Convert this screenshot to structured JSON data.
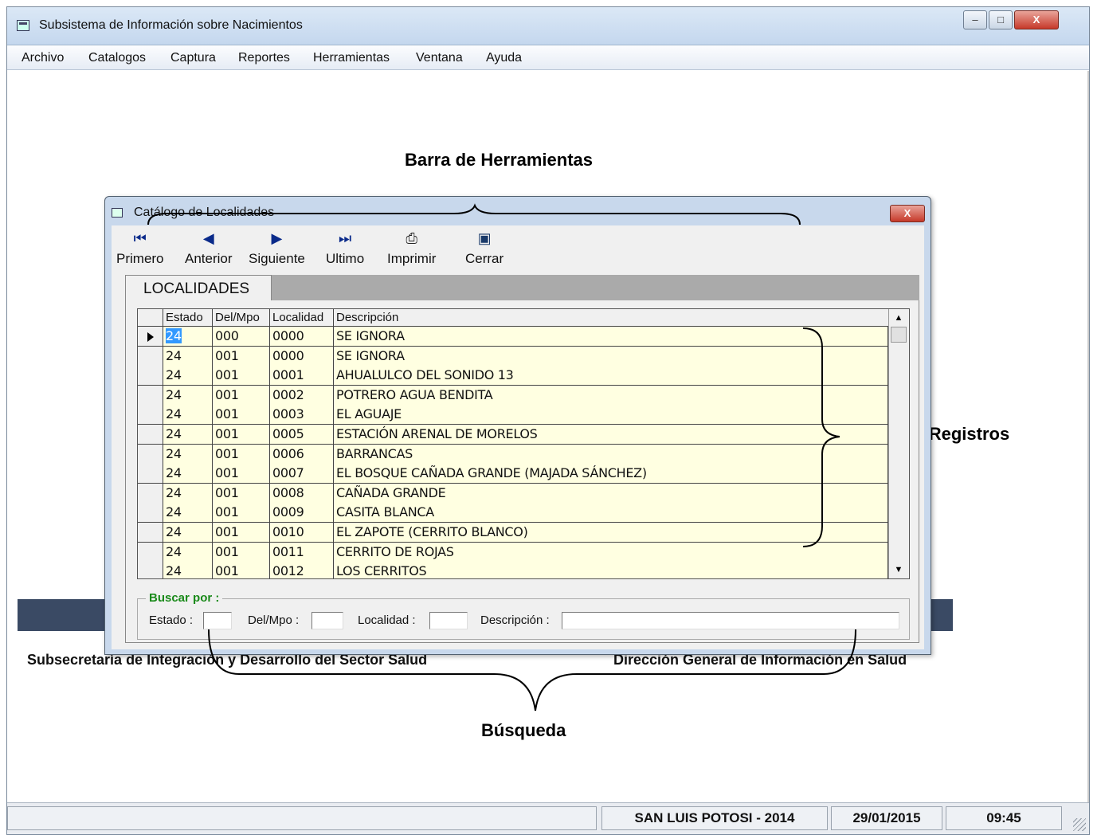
{
  "window": {
    "title": "Subsistema de Información sobre Nacimientos",
    "min_label": "–",
    "max_label": "□",
    "close_label": "X"
  },
  "menu": [
    {
      "label": "Archivo",
      "accel": "A"
    },
    {
      "label": "Catalogos",
      "accel": "C"
    },
    {
      "label": "Captura",
      "accel": "t"
    },
    {
      "label": "Reportes",
      "accel": "R"
    },
    {
      "label": "Herramientas",
      "accel": "H"
    },
    {
      "label": "Ventana",
      "accel": "V"
    },
    {
      "label": "Ayuda",
      "accel": "y"
    }
  ],
  "annotations": {
    "toolbar": "Barra de Herramientas",
    "table": "Tabla de Registros",
    "search": "Búsqueda"
  },
  "footer": {
    "left": "Subsecretaría de Integración y Desarrollo del Sector Salud",
    "right": "Dirección General de Información en Salud"
  },
  "status": {
    "state": "SAN LUIS POTOSI - 2014",
    "date": "29/01/2015",
    "time": "09:45"
  },
  "dialog": {
    "title": "Catálogo de Localidades",
    "close_label": "X",
    "toolbar": [
      {
        "label": "Primero",
        "icon": "first-record-icon",
        "glyph": "⏮"
      },
      {
        "label": "Anterior",
        "icon": "previous-record-icon",
        "glyph": "◀"
      },
      {
        "label": "Siguiente",
        "icon": "next-record-icon",
        "glyph": "▶"
      },
      {
        "label": "Ultimo",
        "icon": "last-record-icon",
        "glyph": "⏭"
      },
      {
        "label": "Imprimir",
        "icon": "printer-icon",
        "glyph": "⎙"
      },
      {
        "label": "Cerrar",
        "icon": "close-door-icon",
        "glyph": "▣"
      }
    ],
    "tab": "LOCALIDADES",
    "grid": {
      "columns": [
        "Estado",
        "Del/Mpo",
        "Localidad",
        "Descripción"
      ],
      "rows": [
        [
          "24",
          "000",
          "0000",
          "SE IGNORA"
        ],
        [
          "24",
          "001",
          "0000",
          "SE IGNORA"
        ],
        [
          "24",
          "001",
          "0001",
          "AHUALULCO DEL SONIDO 13"
        ],
        [
          "24",
          "001",
          "0002",
          "POTRERO AGUA BENDITA"
        ],
        [
          "24",
          "001",
          "0003",
          "EL AGUAJE"
        ],
        [
          "24",
          "001",
          "0005",
          "ESTACIÓN ARENAL DE MORELOS"
        ],
        [
          "24",
          "001",
          "0006",
          "BARRANCAS"
        ],
        [
          "24",
          "001",
          "0007",
          "EL BOSQUE CAÑADA GRANDE (MAJADA SÁNCHEZ)"
        ],
        [
          "24",
          "001",
          "0008",
          "CAÑADA GRANDE"
        ],
        [
          "24",
          "001",
          "0009",
          "CASITA BLANCA"
        ],
        [
          "24",
          "001",
          "0010",
          "EL ZAPOTE (CERRITO BLANCO)"
        ],
        [
          "24",
          "001",
          "0011",
          "CERRITO DE ROJAS"
        ],
        [
          "24",
          "001",
          "0012",
          "LOS CERRITOS"
        ]
      ],
      "selected_row": 0
    },
    "search": {
      "legend": "Buscar por :",
      "estado_label": "Estado :",
      "delmpo_label": "Del/Mpo :",
      "localidad_label": "Localidad :",
      "descripcion_label": "Descripción :",
      "estado_value": "",
      "delmpo_value": "",
      "localidad_value": "",
      "descripcion_value": ""
    }
  },
  "colors": {
    "grid_cell_bg": "#ffffe1",
    "legend_green": "#1a8a1a",
    "close_red": "#c6392a",
    "title_blue": "#c4d7ee"
  }
}
